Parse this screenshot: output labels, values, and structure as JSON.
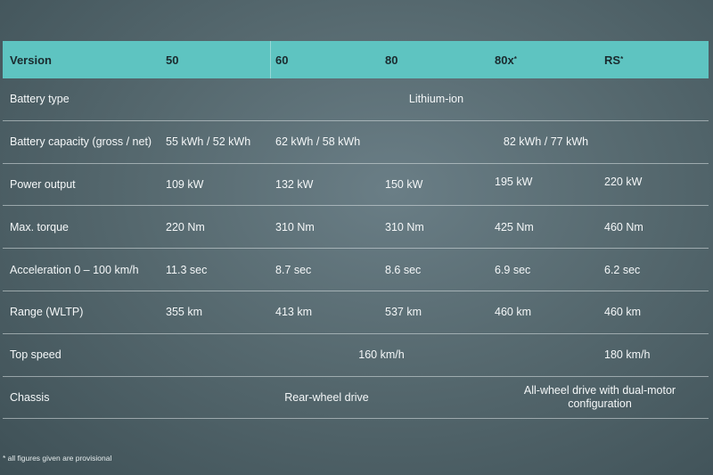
{
  "header": {
    "version_label": "Version",
    "cols": [
      "50",
      "60",
      "80",
      "80x",
      "RS"
    ],
    "col_marks": [
      "",
      "",
      "",
      "*",
      "*"
    ]
  },
  "rows": {
    "battery_type": {
      "label": "Battery type",
      "value": "Lithium-ion"
    },
    "battery_capacity": {
      "label": "Battery capacity (gross / net)",
      "v50": "55 kWh / 52 kWh",
      "v60": "62 kWh / 58 kWh",
      "v80_span": "82 kWh / 77 kWh"
    },
    "power_output": {
      "label": "Power output",
      "values": [
        "109 kW",
        "132 kW",
        "150 kW",
        "195 kW",
        "220 kW"
      ]
    },
    "max_torque": {
      "label": "Max. torque",
      "values": [
        "220 Nm",
        "310 Nm",
        "310 Nm",
        "425 Nm",
        "460 Nm"
      ]
    },
    "acceleration": {
      "label": "Acceleration 0 – 100 km/h",
      "values": [
        "11.3 sec",
        "8.7 sec",
        "8.6 sec",
        "6.9 sec",
        "6.2 sec"
      ]
    },
    "range": {
      "label": "Range (WLTP)",
      "values": [
        "355 km",
        "413 km",
        "537 km",
        "460 km",
        "460 km"
      ]
    },
    "top_speed": {
      "label": "Top speed",
      "span_value": "160 km/h",
      "rs_value": "180 km/h"
    },
    "chassis": {
      "label": "Chassis",
      "rwd": "Rear-wheel drive",
      "awd": "All-wheel drive with dual-motor configuration"
    }
  },
  "footnote": "* all figures given are provisional",
  "colors": {
    "header_bg": "#5ec4c1",
    "background": "#56696f",
    "text": "#ffffff"
  }
}
